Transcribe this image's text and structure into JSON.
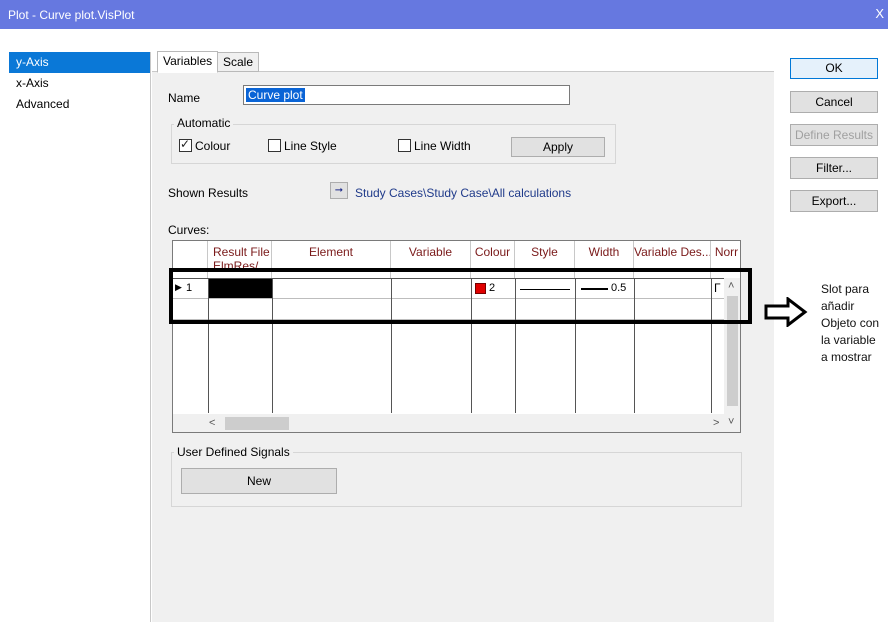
{
  "window": {
    "title": "Plot - Curve plot.VisPlot",
    "close_glyph": "X"
  },
  "nav": {
    "items": [
      {
        "label": "y-Axis",
        "selected": true
      },
      {
        "label": "x-Axis",
        "selected": false
      },
      {
        "label": "Advanced",
        "selected": false
      }
    ]
  },
  "tabs": [
    {
      "label": "Variables",
      "active": true
    },
    {
      "label": "Scale",
      "active": false
    }
  ],
  "name": {
    "label": "Name",
    "value": "Curve plot"
  },
  "automatic": {
    "title": "Automatic",
    "colour": {
      "label": "Colour",
      "checked": true
    },
    "line_style": {
      "label": "Line Style",
      "checked": false
    },
    "line_width": {
      "label": "Line Width",
      "checked": false
    },
    "apply_label": "Apply"
  },
  "shown_results": {
    "label": "Shown Results",
    "arrow_glyph": "➞",
    "path": "Study Cases\\Study Case\\All calculations"
  },
  "curves": {
    "label": "Curves:",
    "columns": [
      "Result File",
      "Element",
      "Variable",
      "Colour",
      "Style",
      "Width",
      "Variable Des...",
      "Norr"
    ],
    "result_file_sub": "ElmRes/",
    "row": {
      "index": "1",
      "colour_value": "2",
      "width_value": "0.5",
      "norr_glyph": "Γ"
    },
    "scroll": {
      "up": "˄",
      "down": "˅",
      "left": "<",
      "right": ">"
    }
  },
  "user_signals": {
    "title": "User Defined Signals",
    "new_label": "New"
  },
  "buttons": {
    "ok": "OK",
    "cancel": "Cancel",
    "define_results": "Define Results",
    "filter": "Filter...",
    "export": "Export..."
  },
  "annotation": {
    "lines": [
      "Slot para",
      "añadir",
      "Objeto con",
      "la variable",
      "a mostrar"
    ]
  },
  "colors": {
    "titlebar": "#6678e0",
    "selection": "#0a78d7",
    "colour_swatch": "#e00000"
  }
}
